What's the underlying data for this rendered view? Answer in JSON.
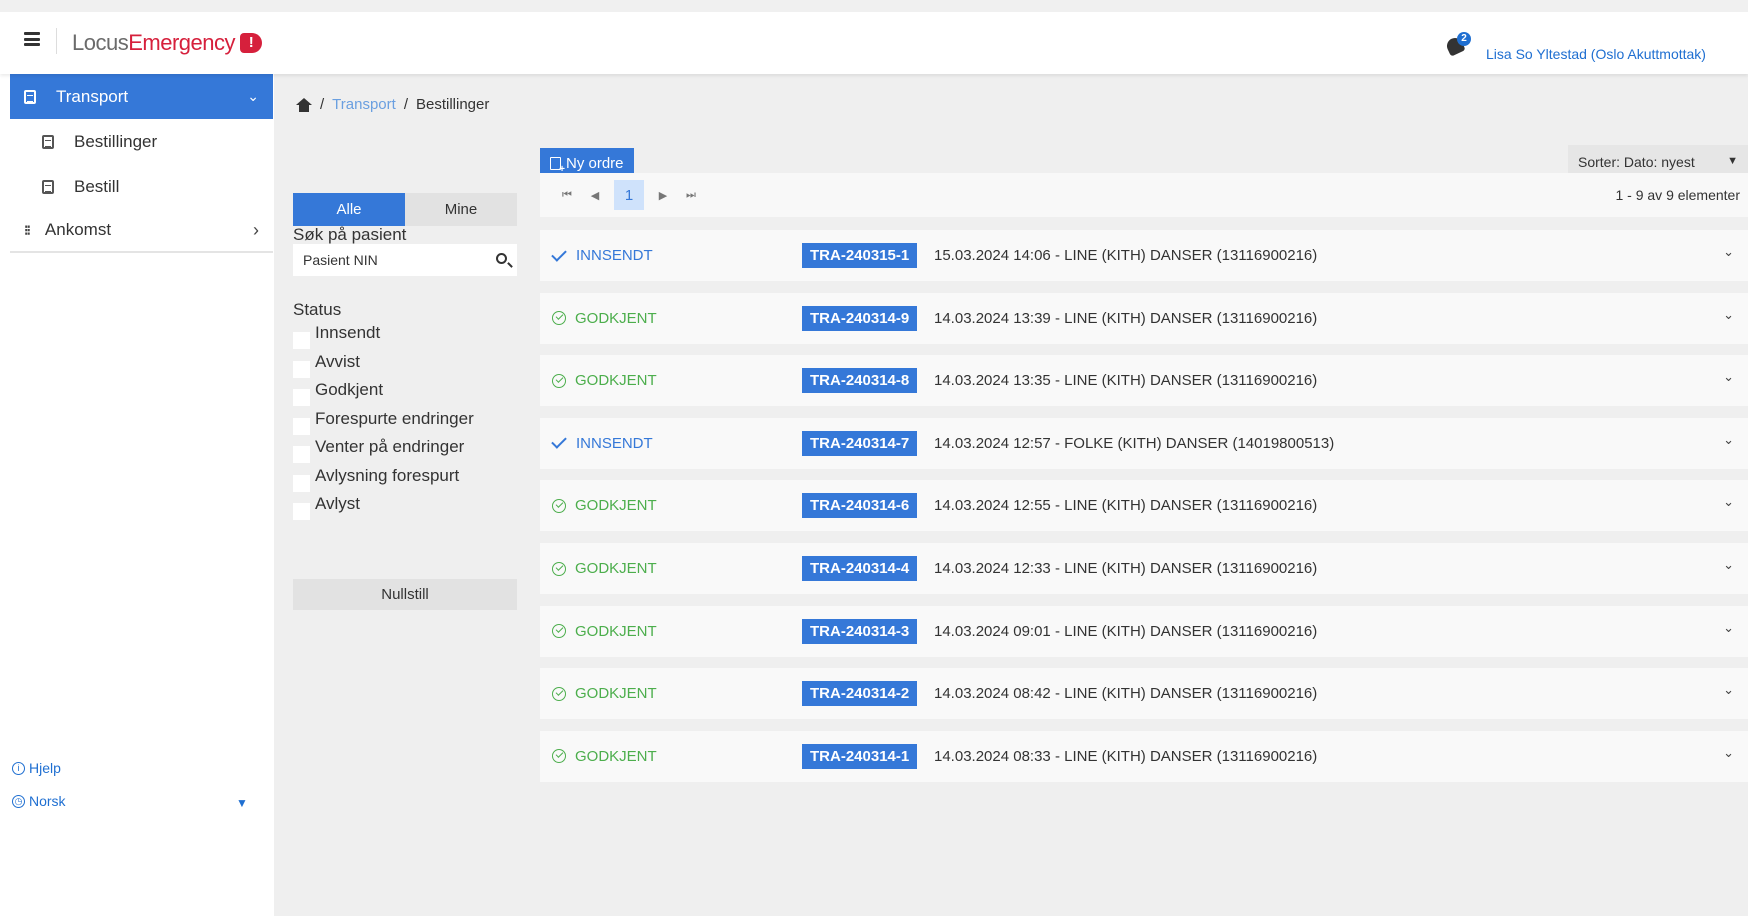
{
  "header": {
    "logo_part1": "Locus",
    "logo_part2": "Emergency",
    "logo_badge": "!",
    "notification_count": "2",
    "user": "Lisa So Yltestad (Oslo Akuttmottak)"
  },
  "sidebar": {
    "active": {
      "label": "Transport",
      "chevron": "⌄"
    },
    "sub_items": [
      {
        "label": "Bestillinger"
      },
      {
        "label": "Bestill"
      }
    ],
    "other": {
      "label": "Ankomst",
      "chevron": "›"
    },
    "help": {
      "icon": "i",
      "label": "Hjelp"
    },
    "language": {
      "icon": "◷",
      "label": "Norsk",
      "arrow": "▼"
    }
  },
  "breadcrumb": {
    "link": "Transport",
    "sep": "/",
    "current": "Bestillinger"
  },
  "filters": {
    "tab_all": "Alle",
    "tab_mine": "Mine",
    "search_label": "Søk på pasient",
    "search_placeholder": "Pasient NIN",
    "status_label": "Status",
    "status_options": [
      {
        "label": "Innsendt"
      },
      {
        "label": "Avvist"
      },
      {
        "label": "Godkjent"
      },
      {
        "label": "Forespurte endringer"
      },
      {
        "label": "Venter på endringer"
      },
      {
        "label": "Avlysning forespurt"
      },
      {
        "label": "Avlyst"
      }
    ],
    "reset_label": "Nullstill"
  },
  "toolbar": {
    "new_order_label": "Ny ordre",
    "sort_label": "Sorter: Dato: nyest",
    "sort_arrow": "▼"
  },
  "pager": {
    "first": "⏮",
    "prev": "◀",
    "current_page": "1",
    "next": "▶",
    "last": "⏭",
    "info": "1 - 9 av 9 elementer"
  },
  "orders": [
    {
      "status": "INNSENDT",
      "status_type": "submitted",
      "id": "TRA-240315-1",
      "desc": "15.03.2024 14:06 - LINE (KITH) DANSER (13116900216)"
    },
    {
      "status": "GODKJENT",
      "status_type": "approved",
      "id": "TRA-240314-9",
      "desc": "14.03.2024 13:39 - LINE (KITH) DANSER (13116900216)"
    },
    {
      "status": "GODKJENT",
      "status_type": "approved",
      "id": "TRA-240314-8",
      "desc": "14.03.2024 13:35 - LINE (KITH) DANSER (13116900216)"
    },
    {
      "status": "INNSENDT",
      "status_type": "submitted",
      "id": "TRA-240314-7",
      "desc": "14.03.2024 12:57 - FOLKE (KITH) DANSER (14019800513)"
    },
    {
      "status": "GODKJENT",
      "status_type": "approved",
      "id": "TRA-240314-6",
      "desc": "14.03.2024 12:55 - LINE (KITH) DANSER (13116900216)"
    },
    {
      "status": "GODKJENT",
      "status_type": "approved",
      "id": "TRA-240314-4",
      "desc": "14.03.2024 12:33 - LINE (KITH) DANSER (13116900216)"
    },
    {
      "status": "GODKJENT",
      "status_type": "approved",
      "id": "TRA-240314-3",
      "desc": "14.03.2024 09:01 - LINE (KITH) DANSER (13116900216)"
    },
    {
      "status": "GODKJENT",
      "status_type": "approved",
      "id": "TRA-240314-2",
      "desc": "14.03.2024 08:42 - LINE (KITH) DANSER (13116900216)"
    },
    {
      "status": "GODKJENT",
      "status_type": "approved",
      "id": "TRA-240314-1",
      "desc": "14.03.2024 08:33 - LINE (KITH) DANSER (13116900216)"
    }
  ],
  "order_chevron": "⌄",
  "colors": {
    "accent": "#3578d8",
    "brand": "#d6203c",
    "approved": "#4cae4c",
    "submitted": "#3578d8"
  }
}
